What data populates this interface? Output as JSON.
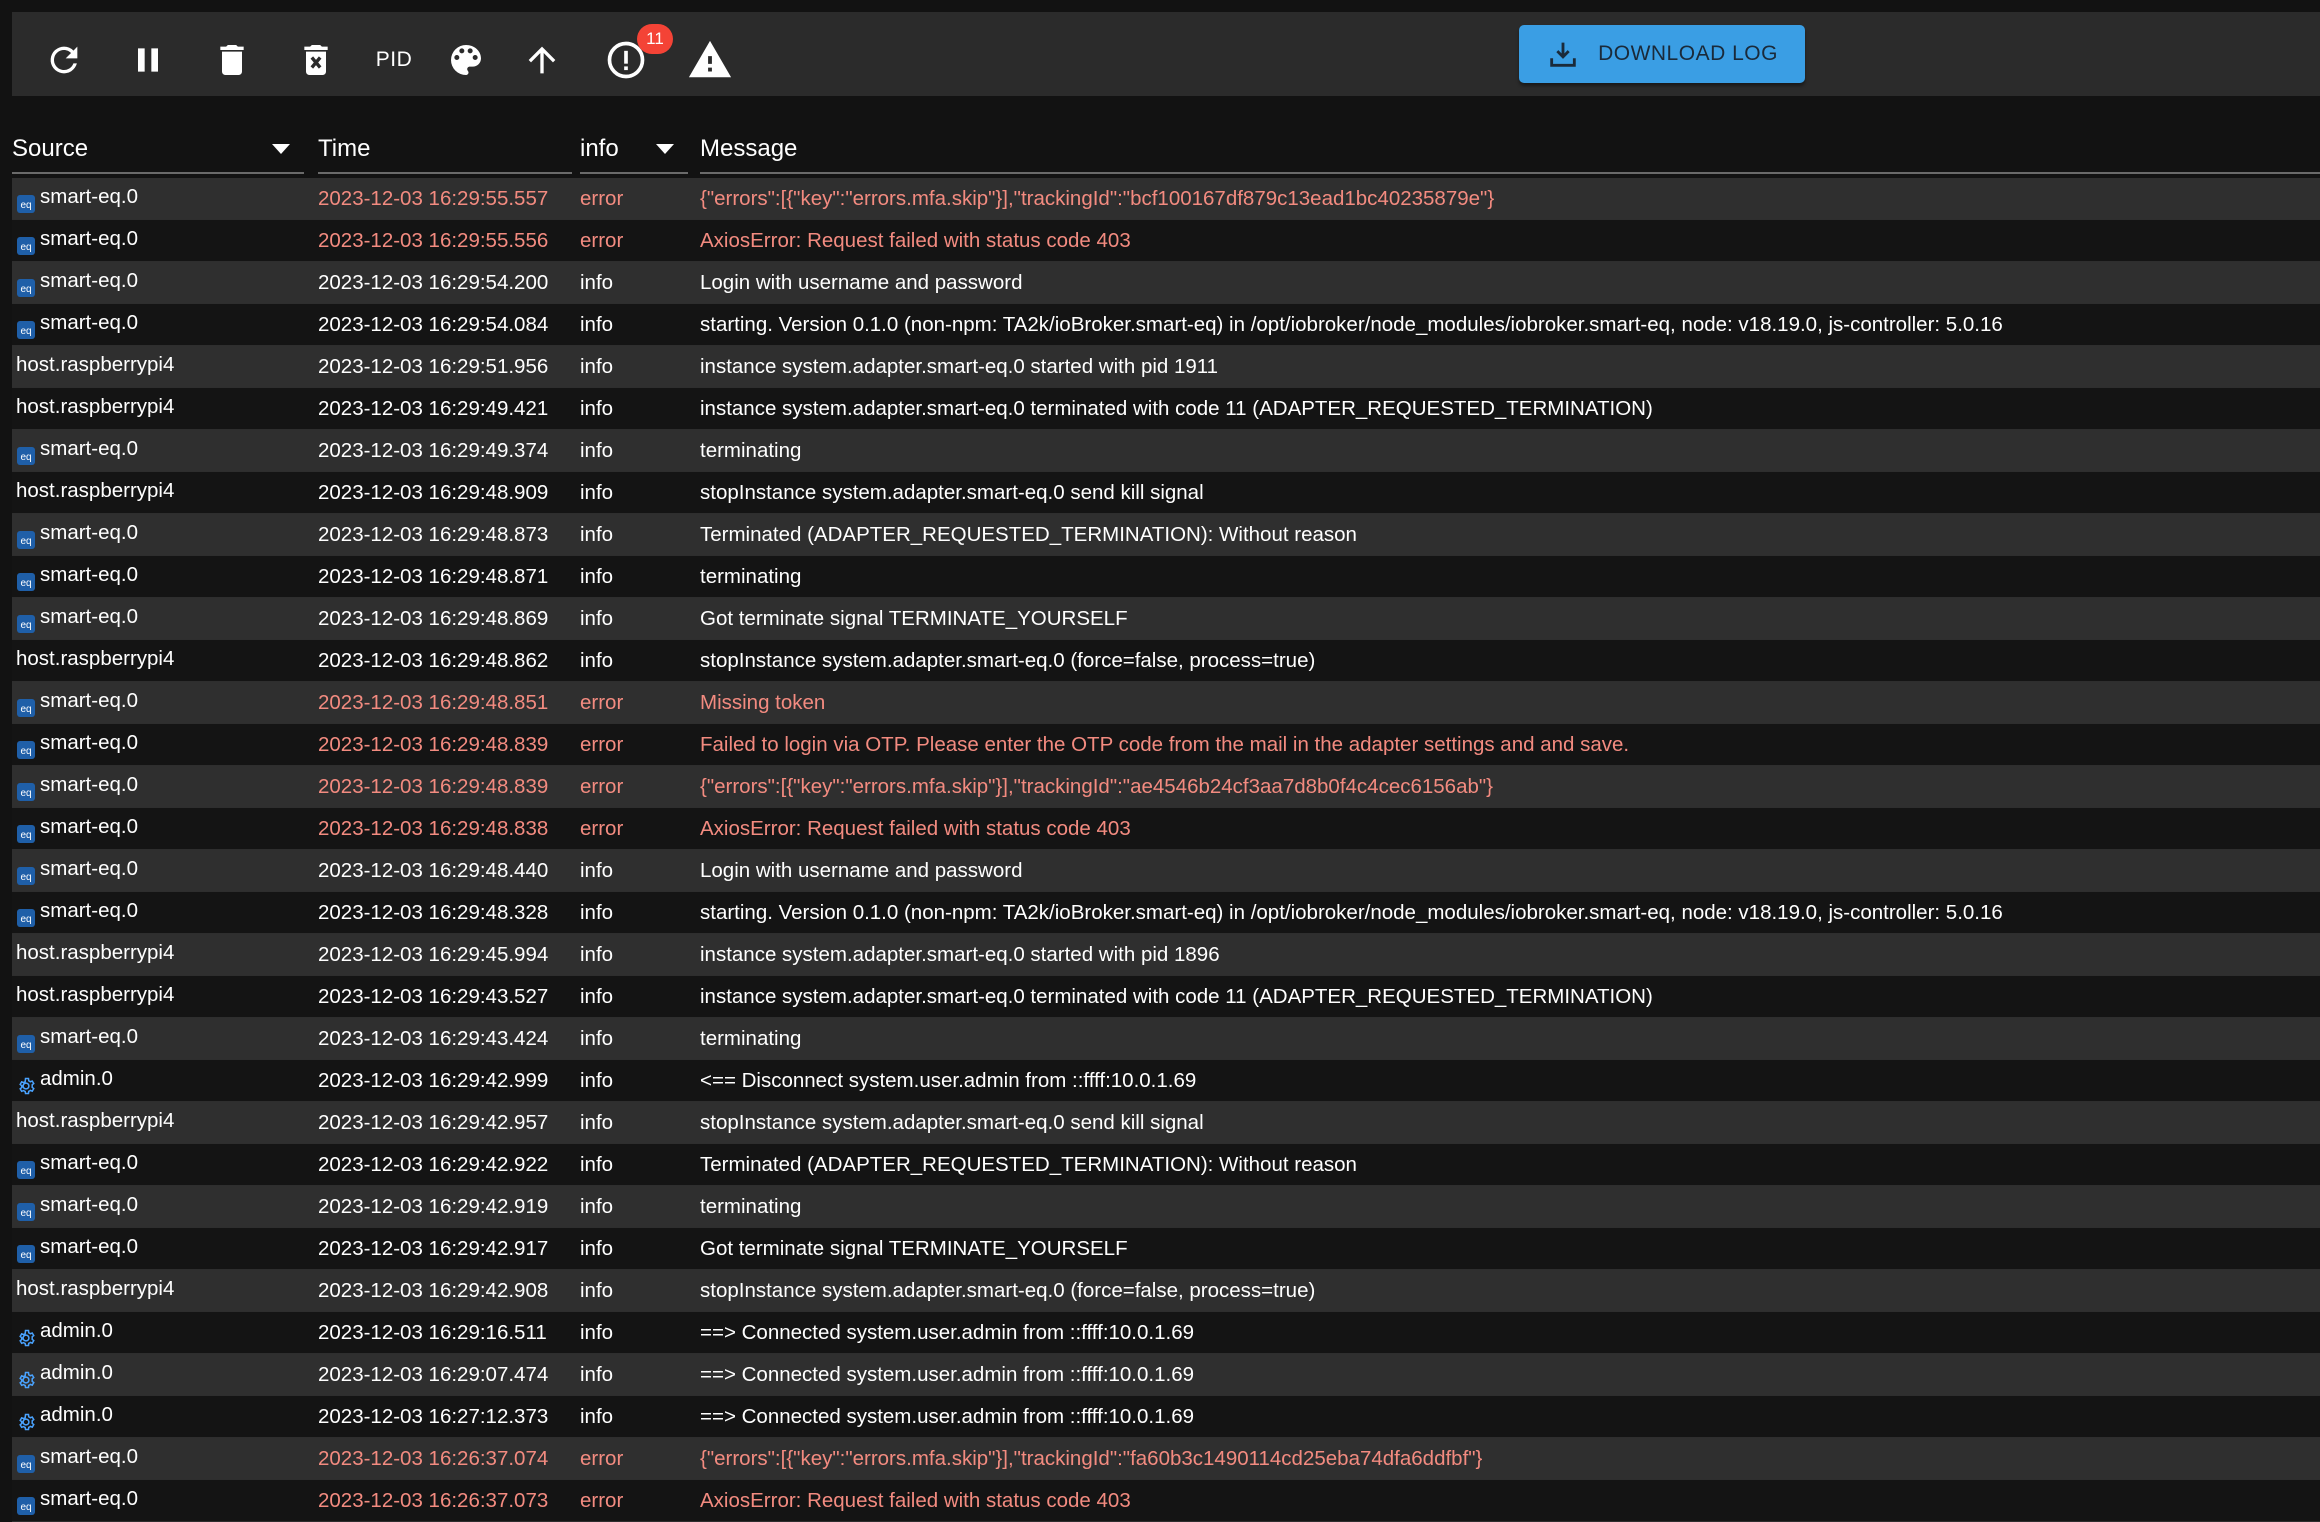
{
  "toolbar": {
    "buttons": [
      {
        "icon": "refresh-icon"
      },
      {
        "icon": "pause-icon"
      },
      {
        "icon": "trash-icon"
      },
      {
        "icon": "delete-log-icon"
      },
      {
        "label": "PID"
      },
      {
        "icon": "palette-icon"
      },
      {
        "icon": "arrow-up-icon"
      },
      {
        "icon": "alert-circle-icon"
      },
      {
        "icon": "warning-icon"
      }
    ],
    "pid_label": "PID",
    "alert_badge": "11",
    "download_label": "DOWNLOAD LOG",
    "colors": {
      "toolbar_bg": "#2b2b2b",
      "download_bg": "#3a9ee4",
      "badge_bg": "#f44336"
    }
  },
  "table": {
    "headers": {
      "source": "Source",
      "time": "Time",
      "severity": "info",
      "message": "Message"
    },
    "colors": {
      "error_text": "#f38b80",
      "info_text": "#ffffff",
      "row_odd": "#2f2f2f",
      "row_even": "#141414"
    },
    "rows": [
      {
        "icon": "smart-eq",
        "source": "smart-eq.0",
        "time": "2023-12-03 16:29:55.557",
        "severity": "error",
        "message": "{\"errors\":[{\"key\":\"errors.mfa.skip\"}],\"trackingId\":\"bcf100167df879c13ead1bc40235879e\"}"
      },
      {
        "icon": "smart-eq",
        "source": "smart-eq.0",
        "time": "2023-12-03 16:29:55.556",
        "severity": "error",
        "message": "AxiosError: Request failed with status code 403"
      },
      {
        "icon": "smart-eq",
        "source": "smart-eq.0",
        "time": "2023-12-03 16:29:54.200",
        "severity": "info",
        "message": "Login with username and password"
      },
      {
        "icon": "smart-eq",
        "source": "smart-eq.0",
        "time": "2023-12-03 16:29:54.084",
        "severity": "info",
        "message": "starting. Version 0.1.0 (non-npm: TA2k/ioBroker.smart-eq) in /opt/iobroker/node_modules/iobroker.smart-eq, node: v18.19.0, js-controller: 5.0.16"
      },
      {
        "icon": "",
        "source": "host.raspberrypi4",
        "time": "2023-12-03 16:29:51.956",
        "severity": "info",
        "message": "instance system.adapter.smart-eq.0 started with pid 1911"
      },
      {
        "icon": "",
        "source": "host.raspberrypi4",
        "time": "2023-12-03 16:29:49.421",
        "severity": "info",
        "message": "instance system.adapter.smart-eq.0 terminated with code 11 (ADAPTER_REQUESTED_TERMINATION)"
      },
      {
        "icon": "smart-eq",
        "source": "smart-eq.0",
        "time": "2023-12-03 16:29:49.374",
        "severity": "info",
        "message": "terminating"
      },
      {
        "icon": "",
        "source": "host.raspberrypi4",
        "time": "2023-12-03 16:29:48.909",
        "severity": "info",
        "message": "stopInstance system.adapter.smart-eq.0 send kill signal"
      },
      {
        "icon": "smart-eq",
        "source": "smart-eq.0",
        "time": "2023-12-03 16:29:48.873",
        "severity": "info",
        "message": "Terminated (ADAPTER_REQUESTED_TERMINATION): Without reason"
      },
      {
        "icon": "smart-eq",
        "source": "smart-eq.0",
        "time": "2023-12-03 16:29:48.871",
        "severity": "info",
        "message": "terminating"
      },
      {
        "icon": "smart-eq",
        "source": "smart-eq.0",
        "time": "2023-12-03 16:29:48.869",
        "severity": "info",
        "message": "Got terminate signal TERMINATE_YOURSELF"
      },
      {
        "icon": "",
        "source": "host.raspberrypi4",
        "time": "2023-12-03 16:29:48.862",
        "severity": "info",
        "message": "stopInstance system.adapter.smart-eq.0 (force=false, process=true)"
      },
      {
        "icon": "smart-eq",
        "source": "smart-eq.0",
        "time": "2023-12-03 16:29:48.851",
        "severity": "error",
        "message": "Missing token"
      },
      {
        "icon": "smart-eq",
        "source": "smart-eq.0",
        "time": "2023-12-03 16:29:48.839",
        "severity": "error",
        "message": "Failed to login via OTP. Please enter the OTP code from the mail in the adapter settings and and save."
      },
      {
        "icon": "smart-eq",
        "source": "smart-eq.0",
        "time": "2023-12-03 16:29:48.839",
        "severity": "error",
        "message": "{\"errors\":[{\"key\":\"errors.mfa.skip\"}],\"trackingId\":\"ae4546b24cf3aa7d8b0f4c4cec6156ab\"}"
      },
      {
        "icon": "smart-eq",
        "source": "smart-eq.0",
        "time": "2023-12-03 16:29:48.838",
        "severity": "error",
        "message": "AxiosError: Request failed with status code 403"
      },
      {
        "icon": "smart-eq",
        "source": "smart-eq.0",
        "time": "2023-12-03 16:29:48.440",
        "severity": "info",
        "message": "Login with username and password"
      },
      {
        "icon": "smart-eq",
        "source": "smart-eq.0",
        "time": "2023-12-03 16:29:48.328",
        "severity": "info",
        "message": "starting. Version 0.1.0 (non-npm: TA2k/ioBroker.smart-eq) in /opt/iobroker/node_modules/iobroker.smart-eq, node: v18.19.0, js-controller: 5.0.16"
      },
      {
        "icon": "",
        "source": "host.raspberrypi4",
        "time": "2023-12-03 16:29:45.994",
        "severity": "info",
        "message": "instance system.adapter.smart-eq.0 started with pid 1896"
      },
      {
        "icon": "",
        "source": "host.raspberrypi4",
        "time": "2023-12-03 16:29:43.527",
        "severity": "info",
        "message": "instance system.adapter.smart-eq.0 terminated with code 11 (ADAPTER_REQUESTED_TERMINATION)"
      },
      {
        "icon": "smart-eq",
        "source": "smart-eq.0",
        "time": "2023-12-03 16:29:43.424",
        "severity": "info",
        "message": "terminating"
      },
      {
        "icon": "admin",
        "source": "admin.0",
        "time": "2023-12-03 16:29:42.999",
        "severity": "info",
        "message": "<== Disconnect system.user.admin from ::ffff:10.0.1.69"
      },
      {
        "icon": "",
        "source": "host.raspberrypi4",
        "time": "2023-12-03 16:29:42.957",
        "severity": "info",
        "message": "stopInstance system.adapter.smart-eq.0 send kill signal"
      },
      {
        "icon": "smart-eq",
        "source": "smart-eq.0",
        "time": "2023-12-03 16:29:42.922",
        "severity": "info",
        "message": "Terminated (ADAPTER_REQUESTED_TERMINATION): Without reason"
      },
      {
        "icon": "smart-eq",
        "source": "smart-eq.0",
        "time": "2023-12-03 16:29:42.919",
        "severity": "info",
        "message": "terminating"
      },
      {
        "icon": "smart-eq",
        "source": "smart-eq.0",
        "time": "2023-12-03 16:29:42.917",
        "severity": "info",
        "message": "Got terminate signal TERMINATE_YOURSELF"
      },
      {
        "icon": "",
        "source": "host.raspberrypi4",
        "time": "2023-12-03 16:29:42.908",
        "severity": "info",
        "message": "stopInstance system.adapter.smart-eq.0 (force=false, process=true)"
      },
      {
        "icon": "admin",
        "source": "admin.0",
        "time": "2023-12-03 16:29:16.511",
        "severity": "info",
        "message": "==> Connected system.user.admin from ::ffff:10.0.1.69"
      },
      {
        "icon": "admin",
        "source": "admin.0",
        "time": "2023-12-03 16:29:07.474",
        "severity": "info",
        "message": "==> Connected system.user.admin from ::ffff:10.0.1.69"
      },
      {
        "icon": "admin",
        "source": "admin.0",
        "time": "2023-12-03 16:27:12.373",
        "severity": "info",
        "message": "==> Connected system.user.admin from ::ffff:10.0.1.69"
      },
      {
        "icon": "smart-eq",
        "source": "smart-eq.0",
        "time": "2023-12-03 16:26:37.074",
        "severity": "error",
        "message": "{\"errors\":[{\"key\":\"errors.mfa.skip\"}],\"trackingId\":\"fa60b3c1490114cd25eba74dfa6ddfbf\"}"
      },
      {
        "icon": "smart-eq",
        "source": "smart-eq.0",
        "time": "2023-12-03 16:26:37.073",
        "severity": "error",
        "message": "AxiosError: Request failed with status code 403"
      }
    ]
  }
}
